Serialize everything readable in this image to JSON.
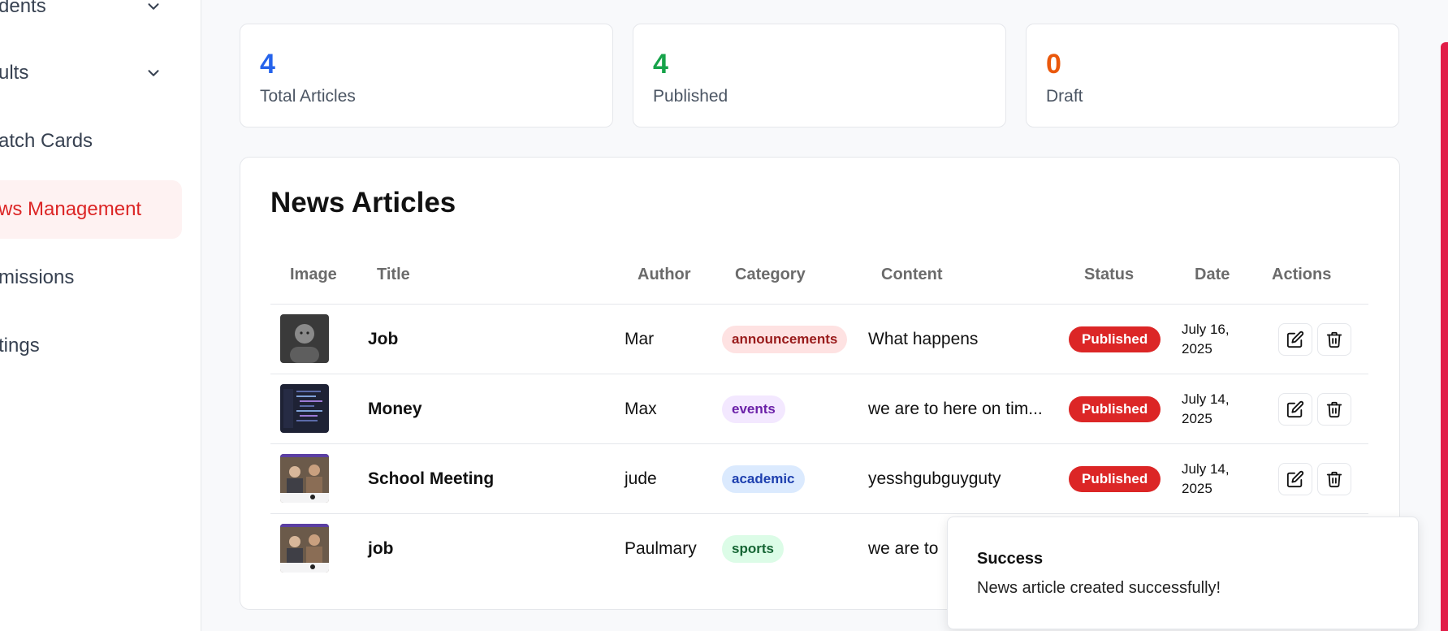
{
  "sidebar": {
    "items": [
      {
        "label": "dents",
        "has_chevron": true
      },
      {
        "label": "ults",
        "has_chevron": true
      },
      {
        "label": "atch Cards",
        "has_chevron": false
      },
      {
        "label": "ws Management",
        "has_chevron": false,
        "active": true
      },
      {
        "label": "missions",
        "has_chevron": false
      },
      {
        "label": "tings",
        "has_chevron": false
      }
    ]
  },
  "stats": [
    {
      "value": "4",
      "label": "Total Articles",
      "color": "#2563eb"
    },
    {
      "value": "4",
      "label": "Published",
      "color": "#16a34a"
    },
    {
      "value": "0",
      "label": "Draft",
      "color": "#ea580c"
    }
  ],
  "articles": {
    "title": "News Articles",
    "columns": [
      "Image",
      "Title",
      "Author",
      "Category",
      "Content",
      "Status",
      "Date",
      "Actions"
    ],
    "rows": [
      {
        "title": "Job",
        "author": "Mar",
        "category": "announcements",
        "content": "What happens",
        "status": "Published",
        "date_line1": "July 16,",
        "date_line2": "2025",
        "image": "portrait-photo"
      },
      {
        "title": "Money",
        "author": "Max",
        "category": "events",
        "content": "we are to here on tim...",
        "status": "Published",
        "date_line1": "July 14,",
        "date_line2": "2025",
        "image": "code-screen-photo"
      },
      {
        "title": "School Meeting",
        "author": "jude",
        "category": "academic",
        "content": "yesshgubguyguty",
        "status": "Published",
        "date_line1": "July 14,",
        "date_line2": "2025",
        "image": "meeting-photo"
      },
      {
        "title": "job",
        "author": "Paulmary",
        "category": "sports",
        "content": "we are to",
        "status": "",
        "date_line1": "",
        "date_line2": "",
        "image": "meeting-photo"
      }
    ]
  },
  "category_colors": {
    "announcements": {
      "bg": "#fee2e2",
      "fg": "#991b1b"
    },
    "events": {
      "bg": "#f3e8ff",
      "fg": "#6b21a8"
    },
    "academic": {
      "bg": "#dbeafe",
      "fg": "#1e40af"
    },
    "sports": {
      "bg": "#dcfce7",
      "fg": "#166534"
    }
  },
  "toast": {
    "title": "Success",
    "message": "News article created successfully!"
  },
  "colors": {
    "accent": "#dc2626",
    "scrollbar": "#e11d48"
  }
}
